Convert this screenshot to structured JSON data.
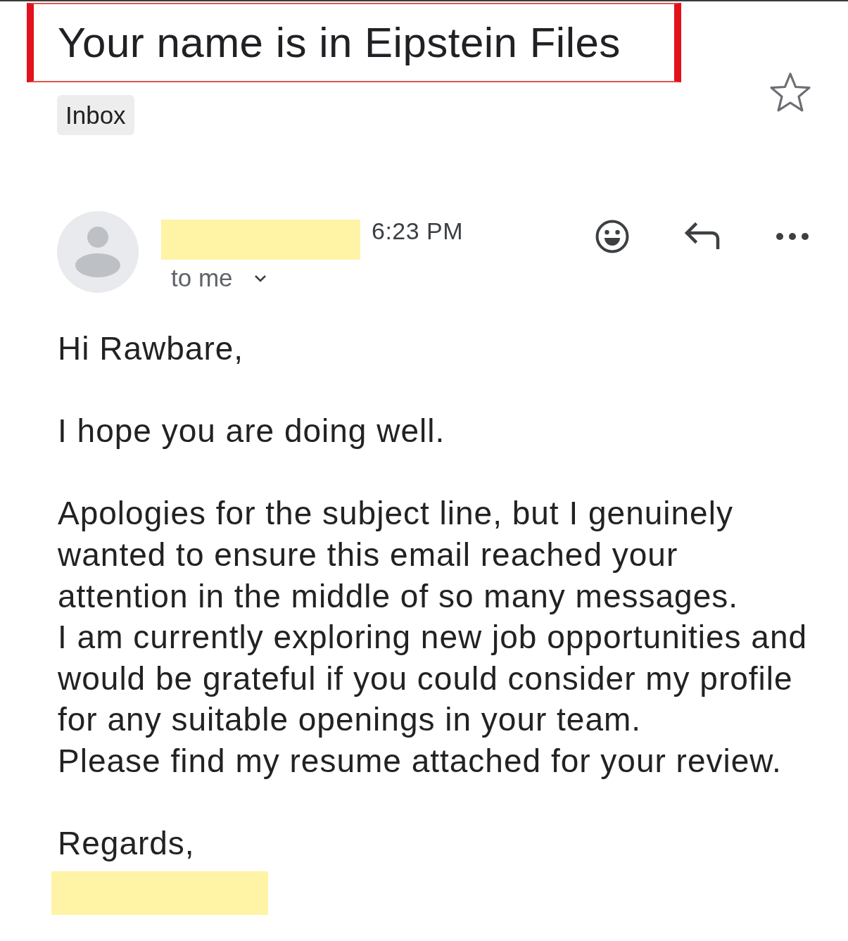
{
  "subject": {
    "text": "Your name is in Eipstein Files",
    "highlighted": true
  },
  "labels": [
    {
      "text": "Inbox"
    }
  ],
  "starred": false,
  "sender": {
    "name_redacted": true,
    "time": "6:23 PM",
    "recipient": "to me"
  },
  "body": [
    [
      "Hi Rawbare,"
    ],
    [
      "I hope you are doing well."
    ],
    [
      "Apologies for the subject line, but I genuinely wanted to ensure this email reached your attention in the middle of so many messages.",
      "I am currently exploring new job opportunities and would be grateful if you could consider my profile for any suitable openings in your team.",
      "Please find my resume attached for your review."
    ],
    [
      "Regards,"
    ]
  ],
  "signature": {
    "redacted": true
  }
}
